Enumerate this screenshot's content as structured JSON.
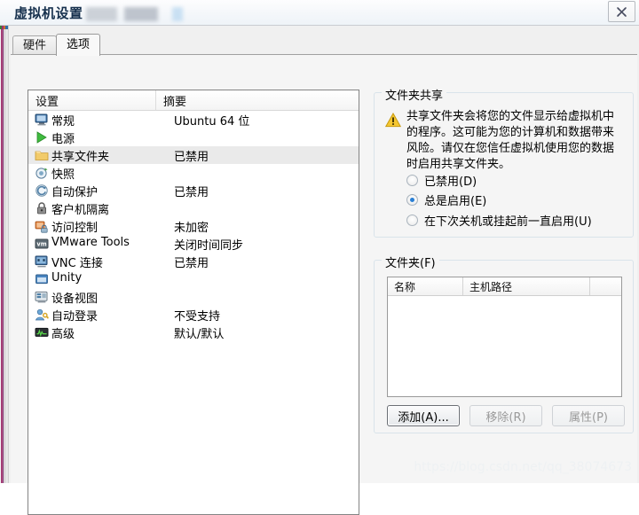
{
  "window": {
    "title": "虚拟机设置",
    "close_label": "×",
    "close_icon": "close-icon"
  },
  "tabs": [
    {
      "label": "硬件",
      "active": false
    },
    {
      "label": "选项",
      "active": true
    }
  ],
  "settings_list": {
    "columns": [
      "设置",
      "摘要"
    ],
    "rows": [
      {
        "icon": "monitor-icon",
        "label": "常规",
        "summary": "Ubuntu 64 位",
        "selected": false
      },
      {
        "icon": "power-play-icon",
        "label": "电源",
        "summary": "",
        "selected": false
      },
      {
        "icon": "folder-icon",
        "label": "共享文件夹",
        "summary": "已禁用",
        "selected": true
      },
      {
        "icon": "snapshot-icon",
        "label": "快照",
        "summary": "",
        "selected": false
      },
      {
        "icon": "autoprotect-icon",
        "label": "自动保护",
        "summary": "已禁用",
        "selected": false
      },
      {
        "icon": "lock-icon",
        "label": "客户机隔离",
        "summary": "",
        "selected": false
      },
      {
        "icon": "access-control-icon",
        "label": "访问控制",
        "summary": "未加密",
        "selected": false
      },
      {
        "icon": "vmware-tools-icon",
        "label": "VMware Tools",
        "summary": "关闭时间同步",
        "selected": false
      },
      {
        "icon": "vnc-icon",
        "label": "VNC 连接",
        "summary": "已禁用",
        "selected": false
      },
      {
        "icon": "unity-icon",
        "label": "Unity",
        "summary": "",
        "selected": false
      },
      {
        "icon": "device-view-icon",
        "label": "设备视图",
        "summary": "",
        "selected": false
      },
      {
        "icon": "auto-login-icon",
        "label": "自动登录",
        "summary": "不受支持",
        "selected": false
      },
      {
        "icon": "advanced-icon",
        "label": "高级",
        "summary": "默认/默认",
        "selected": false
      }
    ]
  },
  "folder_sharing": {
    "group_title": "文件夹共享",
    "warning_icon": "warning-icon",
    "warning_text": "共享文件夹会将您的文件显示给虚拟机中的程序。这可能为您的计算机和数据带来风险。请仅在您信任虚拟机使用您的数据时启用共享文件夹。",
    "options": [
      {
        "label": "已禁用(D)",
        "checked": false
      },
      {
        "label": "总是启用(E)",
        "checked": true
      },
      {
        "label": "在下次关机或挂起前一直启用(U)",
        "checked": false
      }
    ]
  },
  "folders": {
    "group_title": "文件夹(F)",
    "columns": [
      "名称",
      "主机路径"
    ],
    "rows": [],
    "buttons": [
      {
        "label": "添加(A)...",
        "enabled": true,
        "focused": true
      },
      {
        "label": "移除(R)",
        "enabled": false,
        "focused": false
      },
      {
        "label": "属性(P)",
        "enabled": false,
        "focused": false
      }
    ]
  },
  "watermark": "https://blog.csdn.net/qq_38074673",
  "colors": {
    "accent": "#2a7fd4",
    "selection": "#eaeaea",
    "warning": "#f2c12e",
    "title_text": "#16304d"
  }
}
